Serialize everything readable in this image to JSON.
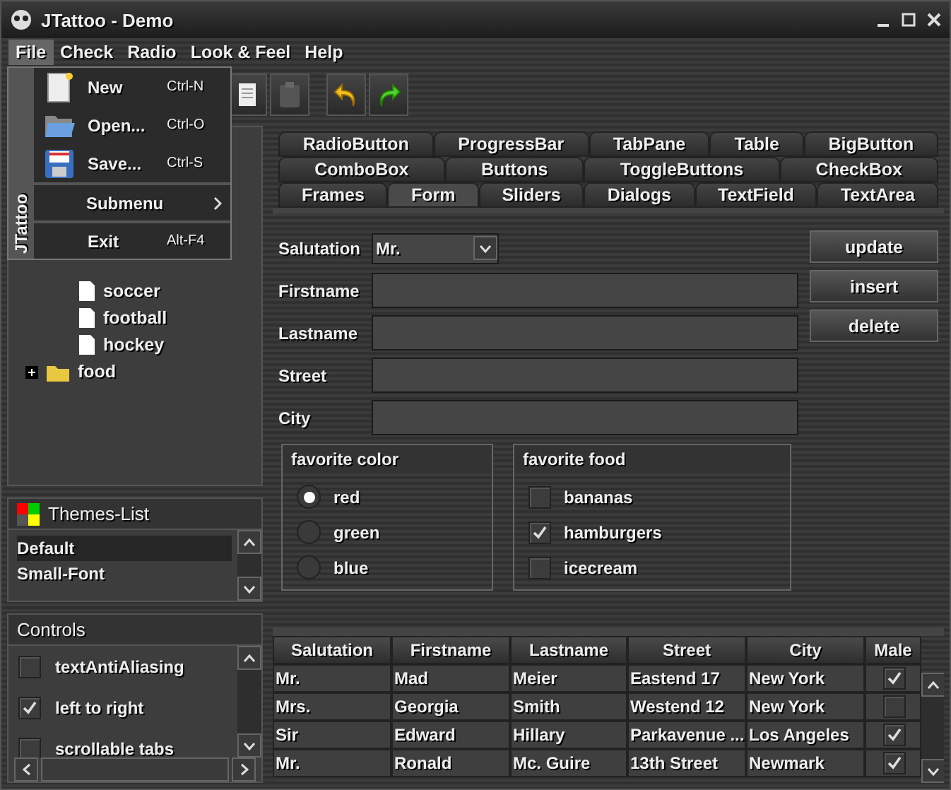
{
  "window": {
    "title": "JTattoo - Demo"
  },
  "menu_bar": [
    {
      "label": "File",
      "selected": true
    },
    {
      "label": "Check",
      "selected": false
    },
    {
      "label": "Radio",
      "selected": false
    },
    {
      "label": "Look & Feel",
      "selected": false
    },
    {
      "label": "Help",
      "selected": false
    }
  ],
  "file_menu": {
    "side_label": "JTattoo",
    "items": [
      {
        "kind": "item",
        "label": "New",
        "shortcut": "Ctrl-N"
      },
      {
        "kind": "item",
        "label": "Open...",
        "shortcut": "Ctrl-O"
      },
      {
        "kind": "item",
        "label": "Save...",
        "shortcut": "Ctrl-S"
      },
      {
        "kind": "submenu",
        "label": "Submenu"
      },
      {
        "kind": "item",
        "label": "Exit",
        "shortcut": "Alt-F4"
      }
    ]
  },
  "tree": [
    {
      "kind": "folder",
      "children": [
        {
          "kind": "leaf",
          "label": "soccer"
        },
        {
          "kind": "leaf",
          "label": "football"
        },
        {
          "kind": "leaf",
          "label": "hockey"
        }
      ]
    },
    {
      "kind": "folder",
      "label": "food",
      "expanded": false
    }
  ],
  "themes_list": {
    "title": "Themes-List",
    "items": [
      {
        "label": "Default",
        "selected": true
      },
      {
        "label": "Small-Font",
        "selected": false
      }
    ]
  },
  "controls": {
    "title": "Controls",
    "items": [
      {
        "label": "textAntiAliasing",
        "checked": false
      },
      {
        "label": "left to right",
        "checked": true
      },
      {
        "label": "scrollable tabs",
        "checked": false
      }
    ]
  },
  "tab_rows": [
    [
      {
        "label": "RadioButton",
        "selected": false
      },
      {
        "label": "ProgressBar",
        "selected": false
      },
      {
        "label": "TabPane",
        "selected": false
      },
      {
        "label": "Table",
        "selected": false
      },
      {
        "label": "BigButton",
        "selected": false
      }
    ],
    [
      {
        "label": "ComboBox",
        "selected": false
      },
      {
        "label": "Buttons",
        "selected": false
      },
      {
        "label": "ToggleButtons",
        "selected": false
      },
      {
        "label": "CheckBox",
        "selected": false
      }
    ],
    [
      {
        "label": "Frames",
        "selected": false
      },
      {
        "label": "Form",
        "selected": true
      },
      {
        "label": "Sliders",
        "selected": false
      },
      {
        "label": "Dialogs",
        "selected": false
      },
      {
        "label": "TextField",
        "selected": false
      },
      {
        "label": "TextArea",
        "selected": false
      }
    ]
  ],
  "form": {
    "salutation": {
      "label": "Salutation",
      "value": "Mr."
    },
    "fields": [
      {
        "label": "Firstname"
      },
      {
        "label": "Lastname"
      },
      {
        "label": "Street"
      },
      {
        "label": "City"
      }
    ],
    "buttons": [
      "update",
      "insert",
      "delete"
    ],
    "color_group": {
      "title": "favorite color",
      "options": [
        {
          "label": "red",
          "selected": true
        },
        {
          "label": "green",
          "selected": false
        },
        {
          "label": "blue",
          "selected": false
        }
      ]
    },
    "food_group": {
      "title": "favorite food",
      "options": [
        {
          "label": "bananas",
          "checked": false
        },
        {
          "label": "hamburgers",
          "checked": true
        },
        {
          "label": "icecream",
          "checked": false
        }
      ]
    }
  },
  "table": {
    "columns": [
      "Salutation",
      "Firstname",
      "Lastname",
      "Street",
      "City",
      "Male"
    ],
    "rows": [
      {
        "cells": [
          "Mr.",
          "Mad",
          "Meier",
          "Eastend 17",
          "New York"
        ],
        "male": true
      },
      {
        "cells": [
          "Mrs.",
          "Georgia",
          "Smith",
          "Westend 12",
          "New York"
        ],
        "male": false
      },
      {
        "cells": [
          "Sir",
          "Edward",
          "Hillary",
          "Parkavenue ...",
          "Los Angeles"
        ],
        "male": true
      },
      {
        "cells": [
          "Mr.",
          "Ronald",
          "Mc. Guire",
          "13th Street",
          "Newmark"
        ],
        "male": true
      }
    ]
  }
}
